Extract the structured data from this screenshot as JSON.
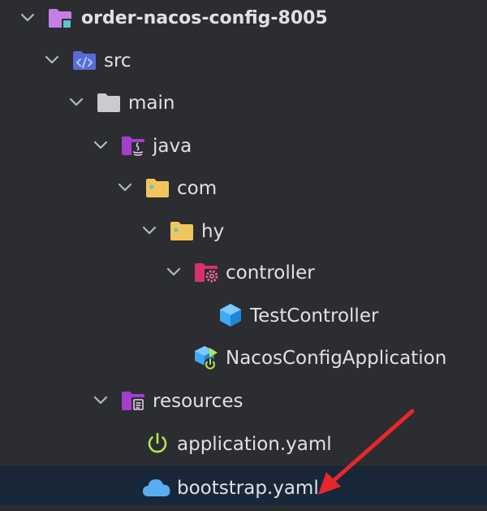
{
  "tree": {
    "project": {
      "label": "order-nacos-config-8005",
      "icon": "module-folder-icon"
    },
    "src": {
      "label": "src",
      "icon": "source-folder-icon"
    },
    "main": {
      "label": "main",
      "icon": "folder-icon"
    },
    "java": {
      "label": "java",
      "icon": "java-source-root-icon"
    },
    "com": {
      "label": "com",
      "icon": "package-icon"
    },
    "hy": {
      "label": "hy",
      "icon": "package-icon"
    },
    "controller": {
      "label": "controller",
      "icon": "controller-package-icon"
    },
    "test_controller": {
      "label": "TestController",
      "icon": "class-icon"
    },
    "nacos_app": {
      "label": "NacosConfigApplication",
      "icon": "spring-boot-app-icon"
    },
    "resources": {
      "label": "resources",
      "icon": "resources-folder-icon"
    },
    "application_yaml": {
      "label": "application.yaml",
      "icon": "spring-config-icon"
    },
    "bootstrap_yaml": {
      "label": "bootstrap.yaml",
      "icon": "cloud-config-icon"
    }
  },
  "colors": {
    "background": "#2b2d30",
    "selected_row": "#18283a",
    "text": "#dfe1e5",
    "module_folder": "#c47ee6",
    "folder_gray": "#c9cbcf",
    "package_yellow": "#f2c55c",
    "java_purple": "#a23fcb",
    "controller_red": "#d6336c",
    "class_blue": "#3fa9f5",
    "spring_green": "#b3e45a",
    "annotation_arrow": "#e8262d"
  }
}
